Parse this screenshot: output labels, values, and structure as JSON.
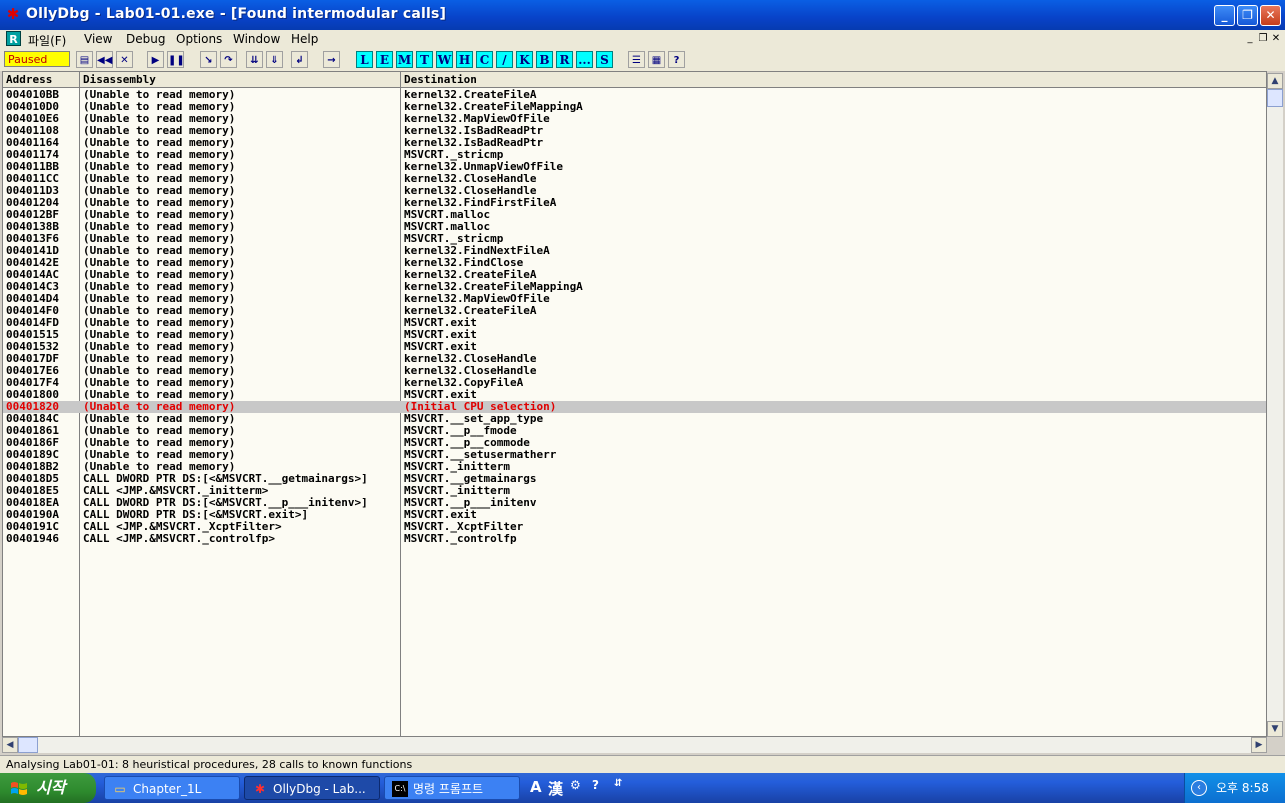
{
  "window": {
    "title": "OllyDbg - Lab01-01.exe - [Found intermodular calls]"
  },
  "menu": {
    "r_icon": "R",
    "items": [
      "파일(F)",
      "View",
      "Debug",
      "Options",
      "Window",
      "Help"
    ]
  },
  "toolbar": {
    "status": "Paused",
    "play_buttons": [
      "open-icon",
      "restart-icon",
      "close-icon",
      "run-icon",
      "pause-icon",
      "step-into-icon",
      "step-over-icon",
      "trace-into-icon",
      "trace-over-icon",
      "execute-till-return-icon",
      "goto-icon"
    ],
    "letter_buttons": [
      "L",
      "E",
      "M",
      "T",
      "W",
      "H",
      "C",
      "/",
      "K",
      "B",
      "R",
      "...",
      "S"
    ]
  },
  "columns": {
    "address": "Address",
    "disassembly": "Disassembly",
    "destination": "Destination"
  },
  "rows": [
    {
      "address": "004010BB",
      "disassembly": "(Unable to read memory)",
      "destination": "kernel32.CreateFileA"
    },
    {
      "address": "004010D0",
      "disassembly": "(Unable to read memory)",
      "destination": "kernel32.CreateFileMappingA"
    },
    {
      "address": "004010E6",
      "disassembly": "(Unable to read memory)",
      "destination": "kernel32.MapViewOfFile"
    },
    {
      "address": "00401108",
      "disassembly": "(Unable to read memory)",
      "destination": "kernel32.IsBadReadPtr"
    },
    {
      "address": "00401164",
      "disassembly": "(Unable to read memory)",
      "destination": "kernel32.IsBadReadPtr"
    },
    {
      "address": "00401174",
      "disassembly": "(Unable to read memory)",
      "destination": "MSVCRT._stricmp"
    },
    {
      "address": "004011BB",
      "disassembly": "(Unable to read memory)",
      "destination": "kernel32.UnmapViewOfFile"
    },
    {
      "address": "004011CC",
      "disassembly": "(Unable to read memory)",
      "destination": "kernel32.CloseHandle"
    },
    {
      "address": "004011D3",
      "disassembly": "(Unable to read memory)",
      "destination": "kernel32.CloseHandle"
    },
    {
      "address": "00401204",
      "disassembly": "(Unable to read memory)",
      "destination": "kernel32.FindFirstFileA"
    },
    {
      "address": "004012BF",
      "disassembly": "(Unable to read memory)",
      "destination": "MSVCRT.malloc"
    },
    {
      "address": "0040138B",
      "disassembly": "(Unable to read memory)",
      "destination": "MSVCRT.malloc"
    },
    {
      "address": "004013F6",
      "disassembly": "(Unable to read memory)",
      "destination": "MSVCRT._stricmp"
    },
    {
      "address": "0040141D",
      "disassembly": "(Unable to read memory)",
      "destination": "kernel32.FindNextFileA"
    },
    {
      "address": "0040142E",
      "disassembly": "(Unable to read memory)",
      "destination": "kernel32.FindClose"
    },
    {
      "address": "004014AC",
      "disassembly": "(Unable to read memory)",
      "destination": "kernel32.CreateFileA"
    },
    {
      "address": "004014C3",
      "disassembly": "(Unable to read memory)",
      "destination": "kernel32.CreateFileMappingA"
    },
    {
      "address": "004014D4",
      "disassembly": "(Unable to read memory)",
      "destination": "kernel32.MapViewOfFile"
    },
    {
      "address": "004014F0",
      "disassembly": "(Unable to read memory)",
      "destination": "kernel32.CreateFileA"
    },
    {
      "address": "004014FD",
      "disassembly": "(Unable to read memory)",
      "destination": "MSVCRT.exit"
    },
    {
      "address": "00401515",
      "disassembly": "(Unable to read memory)",
      "destination": "MSVCRT.exit"
    },
    {
      "address": "00401532",
      "disassembly": "(Unable to read memory)",
      "destination": "MSVCRT.exit"
    },
    {
      "address": "004017DF",
      "disassembly": "(Unable to read memory)",
      "destination": "kernel32.CloseHandle"
    },
    {
      "address": "004017E6",
      "disassembly": "(Unable to read memory)",
      "destination": "kernel32.CloseHandle"
    },
    {
      "address": "004017F4",
      "disassembly": "(Unable to read memory)",
      "destination": "kernel32.CopyFileA"
    },
    {
      "address": "00401800",
      "disassembly": "(Unable to read memory)",
      "destination": "MSVCRT.exit"
    },
    {
      "address": "00401820",
      "disassembly": "(Unable to read memory)",
      "destination": "(Initial CPU selection)",
      "selected": true
    },
    {
      "address": "0040184C",
      "disassembly": "(Unable to read memory)",
      "destination": "MSVCRT.__set_app_type"
    },
    {
      "address": "00401861",
      "disassembly": "(Unable to read memory)",
      "destination": "MSVCRT.__p__fmode"
    },
    {
      "address": "0040186F",
      "disassembly": "(Unable to read memory)",
      "destination": "MSVCRT.__p__commode"
    },
    {
      "address": "0040189C",
      "disassembly": "(Unable to read memory)",
      "destination": "MSVCRT.__setusermatherr"
    },
    {
      "address": "004018B2",
      "disassembly": "(Unable to read memory)",
      "destination": "MSVCRT._initterm"
    },
    {
      "address": "004018D5",
      "disassembly": "CALL DWORD PTR DS:[<&MSVCRT.__getmainargs>]",
      "destination": "MSVCRT.__getmainargs"
    },
    {
      "address": "004018E5",
      "disassembly": "CALL <JMP.&MSVCRT._initterm>",
      "destination": "MSVCRT._initterm"
    },
    {
      "address": "004018EA",
      "disassembly": "CALL DWORD PTR DS:[<&MSVCRT.__p___initenv>]",
      "destination": "MSVCRT.__p___initenv"
    },
    {
      "address": "0040190A",
      "disassembly": "CALL DWORD PTR DS:[<&MSVCRT.exit>]",
      "destination": "MSVCRT.exit"
    },
    {
      "address": "0040191C",
      "disassembly": "CALL <JMP.&MSVCRT._XcptFilter>",
      "destination": "MSVCRT._XcptFilter"
    },
    {
      "address": "00401946",
      "disassembly": "CALL <JMP.&MSVCRT._controlfp>",
      "destination": "MSVCRT._controlfp"
    }
  ],
  "statusbar": {
    "text": "Analysing Lab01-01: 8 heuristical procedures, 28 calls to known functions"
  },
  "taskbar": {
    "start_label": "시작",
    "tasks": [
      {
        "label": "Chapter_1L",
        "icon": "folder-icon"
      },
      {
        "label": "OllyDbg - Lab...",
        "icon": "ollydbg-icon",
        "active": true
      },
      {
        "label": "명령 프롬프트",
        "icon": "cmd-icon"
      }
    ],
    "ime": [
      "A",
      "漢"
    ],
    "clock": "오후 8:58"
  },
  "colors": {
    "selected_row_text": "#e00000",
    "paused_bg": "#ffff00",
    "letter_btn_bg": "#00ffff"
  }
}
